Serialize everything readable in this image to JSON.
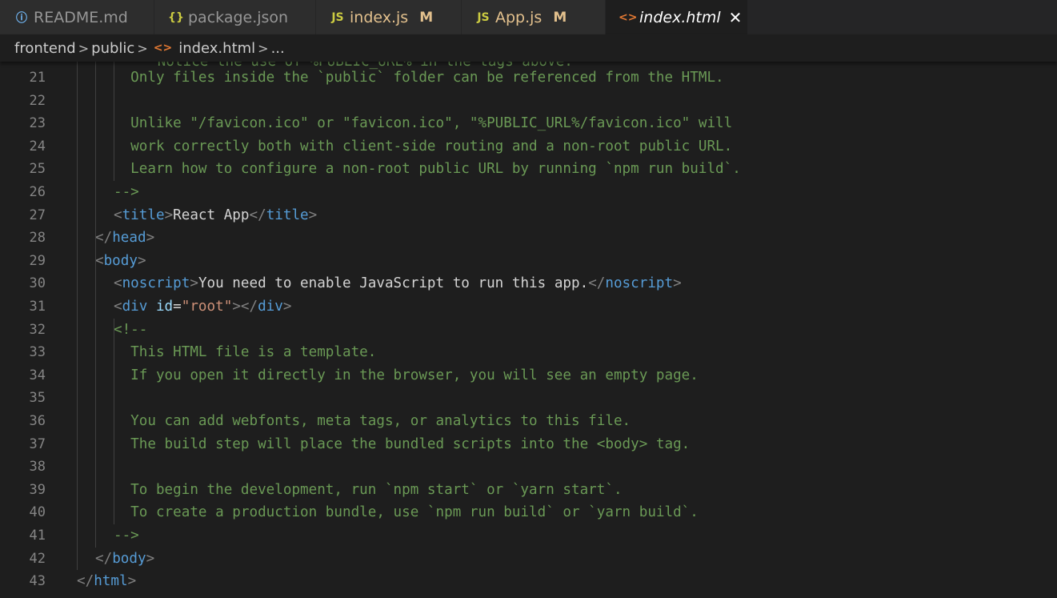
{
  "tabs": [
    {
      "label": "README.md",
      "icon": "info-icon",
      "icon_glyph": "ⓘ",
      "icon_color": "#75beff",
      "modified": ""
    },
    {
      "label": "package.json",
      "icon": "json-braces-icon",
      "icon_glyph": "{}",
      "icon_color": "#cbcb41",
      "modified": ""
    },
    {
      "label": "index.js",
      "icon": "js-file-icon",
      "icon_glyph": "JS",
      "icon_color": "#cbcb41",
      "modified": "M"
    },
    {
      "label": "App.js",
      "icon": "js-file-icon",
      "icon_glyph": "JS",
      "icon_color": "#cbcb41",
      "modified": "M"
    },
    {
      "label": "index.html",
      "icon": "html-file-icon",
      "icon_glyph": "<>",
      "icon_color": "#e37933",
      "modified": "",
      "active": true,
      "close_glyph": "✕"
    }
  ],
  "breadcrumb": {
    "items": [
      "frontend",
      "public",
      "index.html",
      "..."
    ],
    "separator": ">",
    "file_icon": "html-file-icon",
    "file_icon_glyph": "<>"
  },
  "colors": {
    "comment": "#6a9955",
    "punctuation": "#808080",
    "tag": "#569cd6",
    "attribute": "#9cdcfe",
    "string": "#ce9178",
    "text": "#d4d4d4",
    "line_number": "#858585",
    "modified_badge": "#e2c08d"
  },
  "editor": {
    "partial_top_line": "   Notice the use of %PUBLIC_URL% in the tags above.",
    "lines": [
      {
        "num": "21",
        "tokens": [
          [
            "c",
            "  Only files inside the `public` folder can be referenced from the HTML."
          ]
        ]
      },
      {
        "num": "22",
        "tokens": []
      },
      {
        "num": "23",
        "tokens": [
          [
            "c",
            "  Unlike \"/favicon.ico\" or \"favicon.ico\", \"%PUBLIC_URL%/favicon.ico\" will"
          ]
        ]
      },
      {
        "num": "24",
        "tokens": [
          [
            "c",
            "  work correctly both with client-side routing and a non-root public URL."
          ]
        ]
      },
      {
        "num": "25",
        "tokens": [
          [
            "c",
            "  Learn how to configure a non-root public URL by running `npm run build`."
          ]
        ]
      },
      {
        "num": "26",
        "tokens": [
          [
            "c",
            "-->"
          ]
        ]
      },
      {
        "num": "27",
        "tokens": [
          [
            "p",
            "<"
          ],
          [
            "t",
            "title"
          ],
          [
            "p",
            ">"
          ],
          [
            "x",
            "React App"
          ],
          [
            "p",
            "</"
          ],
          [
            "t",
            "title"
          ],
          [
            "p",
            ">"
          ]
        ]
      },
      {
        "num": "28",
        "tokens": [
          [
            "p",
            "</"
          ],
          [
            "t",
            "head"
          ],
          [
            "p",
            ">"
          ]
        ]
      },
      {
        "num": "29",
        "tokens": [
          [
            "p",
            "<"
          ],
          [
            "t",
            "body"
          ],
          [
            "p",
            ">"
          ]
        ]
      },
      {
        "num": "30",
        "tokens": [
          [
            "p",
            "<"
          ],
          [
            "t",
            "noscript"
          ],
          [
            "p",
            ">"
          ],
          [
            "x",
            "You need to enable JavaScript to run this app."
          ],
          [
            "p",
            "</"
          ],
          [
            "t",
            "noscript"
          ],
          [
            "p",
            ">"
          ]
        ]
      },
      {
        "num": "31",
        "tokens": [
          [
            "p",
            "<"
          ],
          [
            "t",
            "div"
          ],
          [
            "x",
            " "
          ],
          [
            "a",
            "id"
          ],
          [
            "x",
            "="
          ],
          [
            "s",
            "\"root\""
          ],
          [
            "p",
            "></"
          ],
          [
            "t",
            "div"
          ],
          [
            "p",
            ">"
          ]
        ]
      },
      {
        "num": "32",
        "tokens": [
          [
            "c",
            "<!--"
          ]
        ]
      },
      {
        "num": "33",
        "tokens": [
          [
            "c",
            "  This HTML file is a template."
          ]
        ]
      },
      {
        "num": "34",
        "tokens": [
          [
            "c",
            "  If you open it directly in the browser, you will see an empty page."
          ]
        ]
      },
      {
        "num": "35",
        "tokens": []
      },
      {
        "num": "36",
        "tokens": [
          [
            "c",
            "  You can add webfonts, meta tags, or analytics to this file."
          ]
        ]
      },
      {
        "num": "37",
        "tokens": [
          [
            "c",
            "  The build step will place the bundled scripts into the <body> tag."
          ]
        ]
      },
      {
        "num": "38",
        "tokens": []
      },
      {
        "num": "39",
        "tokens": [
          [
            "c",
            "  To begin the development, run `npm start` or `yarn start`."
          ]
        ]
      },
      {
        "num": "40",
        "tokens": [
          [
            "c",
            "  To create a production bundle, use `npm run build` or `yarn build`."
          ]
        ]
      },
      {
        "num": "41",
        "tokens": [
          [
            "c",
            "-->"
          ]
        ]
      },
      {
        "num": "42",
        "tokens": [
          [
            "p",
            "</"
          ],
          [
            "t",
            "body"
          ],
          [
            "p",
            ">"
          ]
        ]
      },
      {
        "num": "43",
        "tokens": [
          [
            "p",
            "</"
          ],
          [
            "t",
            "html"
          ],
          [
            "p",
            ">"
          ]
        ]
      }
    ]
  }
}
